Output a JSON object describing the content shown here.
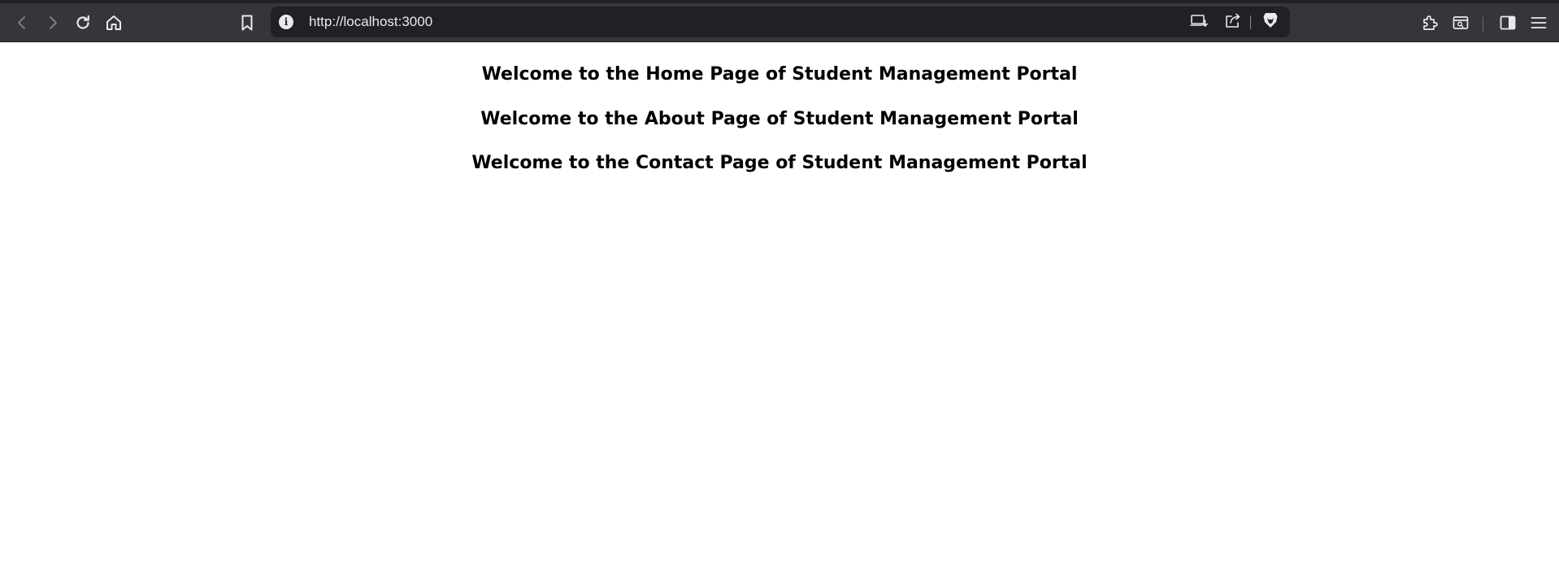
{
  "browser": {
    "url": "http://localhost:3000",
    "info_glyph": "i",
    "icons": {
      "back": "back-arrow-icon",
      "forward": "forward-arrow-icon",
      "reload": "reload-icon",
      "home": "home-icon",
      "bookmark": "bookmark-icon",
      "site_info": "info-icon",
      "install": "install-app-icon",
      "share": "share-icon",
      "brave": "brave-shield-icon",
      "extensions": "extensions-icon",
      "tab_search": "tab-search-icon",
      "sidebar": "sidebar-icon",
      "menu": "menu-icon"
    }
  },
  "page": {
    "headings": [
      "Welcome to the Home Page of Student Management Portal",
      "Welcome to the About Page of Student Management Portal",
      "Welcome to the Contact Page of Student Management Portal"
    ]
  },
  "colors": {
    "toolbar": "#35363a",
    "url_bar": "#202124",
    "icon": "#e8eaed",
    "icon_disabled": "#7b7c80",
    "brave_orange": "#e8eaed",
    "page_background": "#ffffff",
    "heading_text": "#000000"
  }
}
